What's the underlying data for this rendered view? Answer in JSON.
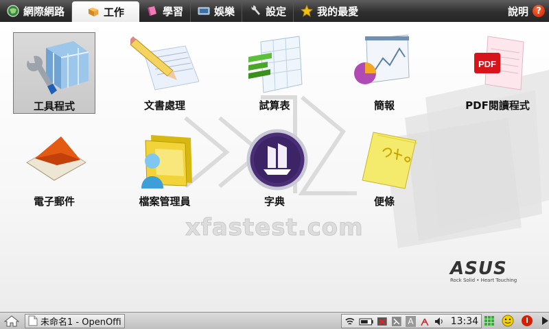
{
  "tabs": [
    {
      "label": "網際網路",
      "icon": "internet-globe-icon",
      "active": false
    },
    {
      "label": "工作",
      "icon": "work-folder-icon",
      "active": true
    },
    {
      "label": "學習",
      "icon": "learning-book-icon",
      "active": false
    },
    {
      "label": "娛樂",
      "icon": "entertainment-tv-icon",
      "active": false
    },
    {
      "label": "設定",
      "icon": "settings-wrench-icon",
      "active": false
    },
    {
      "label": "我的最愛",
      "icon": "favorites-star-icon",
      "active": false
    }
  ],
  "help": {
    "label": "說明",
    "icon": "help-question-icon",
    "glyph": "?"
  },
  "apps": [
    {
      "label": "工具程式",
      "icon": "tools-cube-wrench-icon",
      "selected": true
    },
    {
      "label": "文書處理",
      "icon": "word-processor-pencil-icon",
      "selected": false
    },
    {
      "label": "試算表",
      "icon": "spreadsheet-icon",
      "selected": false
    },
    {
      "label": "簡報",
      "icon": "presentation-chart-icon",
      "selected": false
    },
    {
      "label": "PDF閱讀程式",
      "icon": "pdf-reader-icon",
      "selected": false
    },
    {
      "label": "電子郵件",
      "icon": "email-envelope-icon",
      "selected": false
    },
    {
      "label": "檔案管理員",
      "icon": "file-manager-folder-icon",
      "selected": false
    },
    {
      "label": "字典",
      "icon": "dictionary-ship-icon",
      "selected": false
    },
    {
      "label": "便條",
      "icon": "note-pad-icon",
      "selected": false
    }
  ],
  "branding": {
    "logo": "ASUS",
    "tagline": "Rock Solid • Heart Touching",
    "watermark": "xfastest.com"
  },
  "taskbar": {
    "window_title": "未命名1 - OpenOffi",
    "pdf_glyph": "PDF",
    "tray_a_glyph": "A",
    "clock": "13:34",
    "home_icon": "home-icon",
    "colors": {
      "accent_green": "#3aa83a",
      "alert_red": "#d61e00",
      "smiley": "#f2d000"
    }
  }
}
